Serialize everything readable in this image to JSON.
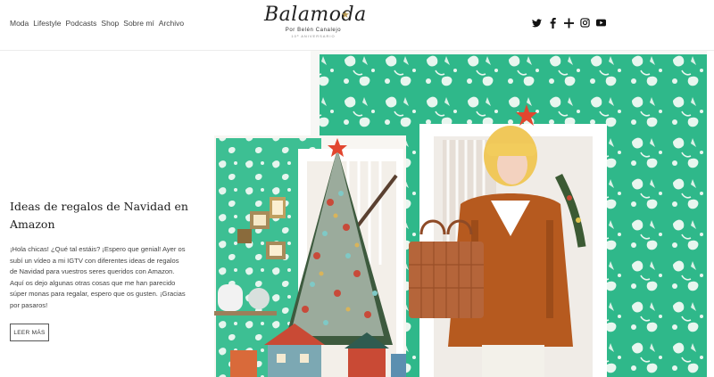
{
  "nav": {
    "items": [
      "Moda",
      "Lifestyle",
      "Podcasts",
      "Shop",
      "Sobre mí",
      "Archivo"
    ]
  },
  "logo": {
    "name": "Balamoda",
    "byline": "Por Belén Canalejo",
    "tagline": "10º ANIVERSARIO"
  },
  "social": {
    "icons": [
      "twitter-icon",
      "facebook-icon",
      "plus-icon",
      "instagram-icon",
      "youtube-icon"
    ]
  },
  "article": {
    "title": "Ideas de regalos de Navidad en Amazon",
    "excerpt": "¡Hola chicas! ¿Qué tal estáis? ¡Espero que genial! Ayer os subí un vídeo a mi IGTV con diferentes ideas de regalos de Navidad para vuestros seres queridos con Amazon. Aquí os dejo algunas otras cosas que me han parecido súper monas para regalar, espero que os gusten. ¡Gracias por pasaros!",
    "read_more": "LEER MÁS"
  },
  "colors": {
    "wallpaper": "#2fb88a",
    "coat": "#b65a1f",
    "bag": "#b5653a",
    "star": "#e2462f"
  }
}
